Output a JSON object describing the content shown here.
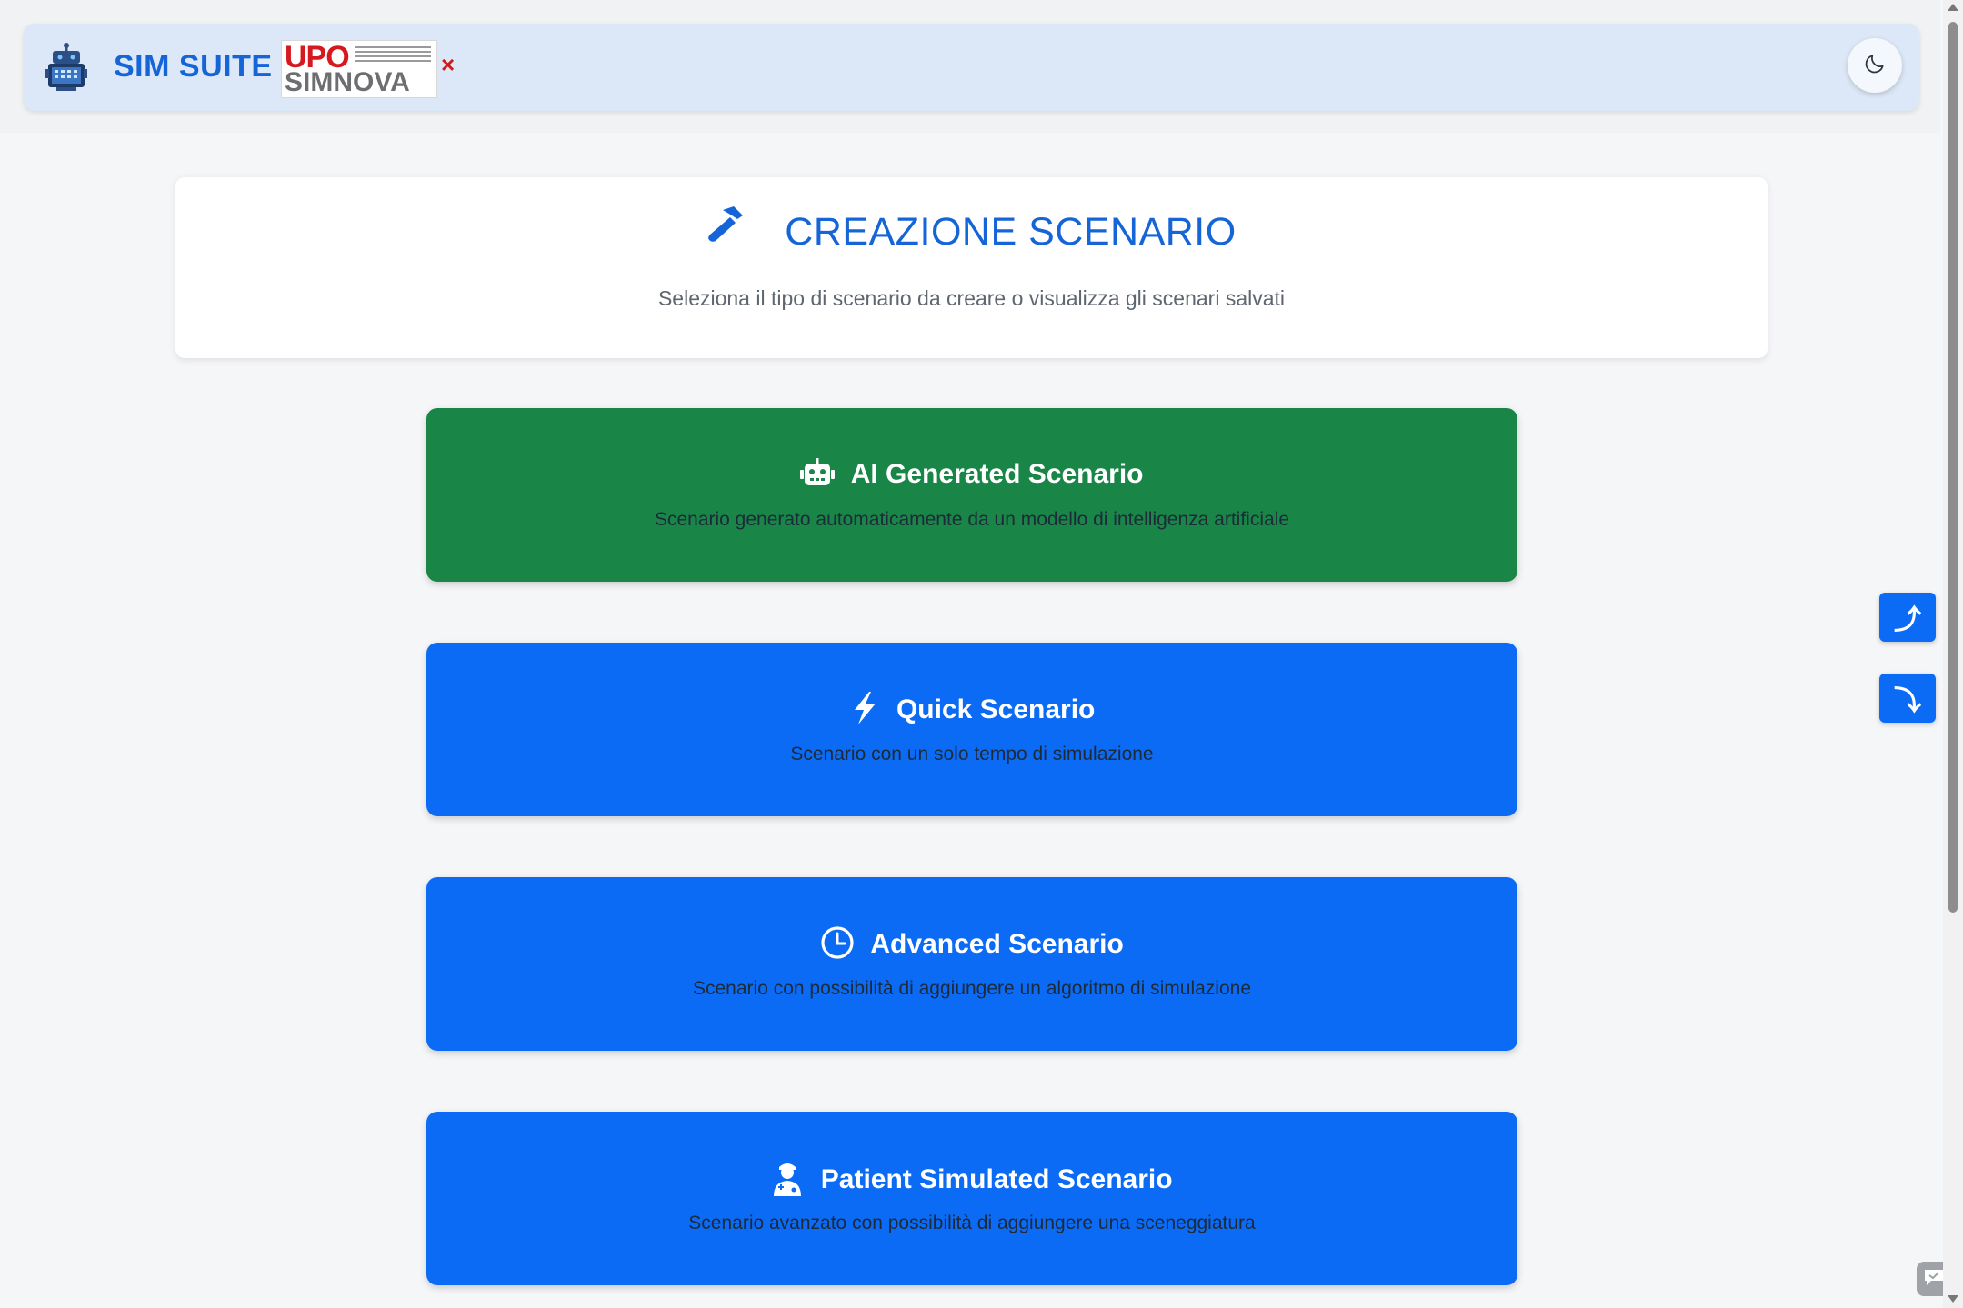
{
  "navbar": {
    "brand": "SIM SUITE",
    "logo": {
      "upo": "UPO",
      "simnova": "SIMNOVA"
    },
    "close_symbol": "×",
    "icons": {
      "brand": "robot-monitor-icon",
      "theme": "moon-icon"
    }
  },
  "header": {
    "title": "CREAZIONE SCENARIO",
    "subtitle": "Seleziona il tipo di scenario da creare o visualizza gli scenari salvati",
    "icon": "hammer-icon"
  },
  "scenarios": [
    {
      "title": "AI Generated Scenario",
      "description": "Scenario generato automaticamente da un modello di intelligenza artificiale",
      "icon": "robot-icon",
      "color": "#198547"
    },
    {
      "title": "Quick Scenario",
      "description": "Scenario con un solo tempo di simulazione",
      "icon": "lightning-icon",
      "color": "#0b6bf4"
    },
    {
      "title": "Advanced Scenario",
      "description": "Scenario con possibilità di aggiungere un algoritmo di simulazione",
      "icon": "clock-icon",
      "color": "#0b6bf4"
    },
    {
      "title": "Patient Simulated Scenario",
      "description": "Scenario avanzato con possibilità di aggiungere una sceneggiatura",
      "icon": "patient-icon",
      "color": "#0b6bf4"
    }
  ],
  "floating": {
    "up": "⤴",
    "down": "⤵"
  },
  "colors": {
    "primary": "#1565d8",
    "accent_blue": "#0b6bf4",
    "accent_green": "#198547",
    "navbar_bg": "#dce8f7"
  }
}
